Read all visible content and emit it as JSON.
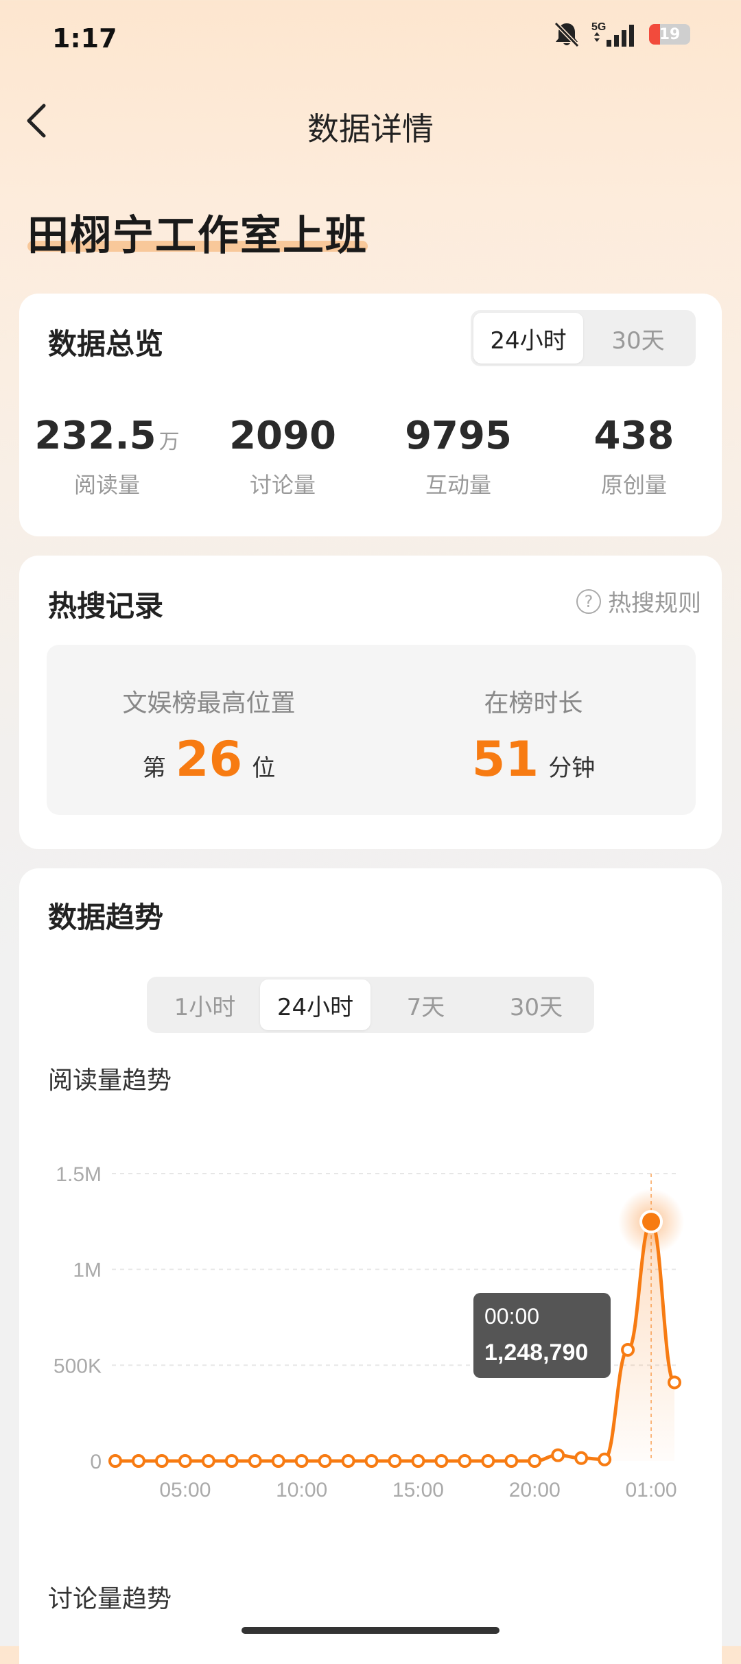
{
  "status_bar": {
    "time": "1:17",
    "battery": "19",
    "network": "5G"
  },
  "header": {
    "title": "数据详情"
  },
  "topic": {
    "title": "田栩宁工作室上班"
  },
  "overview": {
    "title": "数据总览",
    "range_tabs": [
      {
        "label": "24小时",
        "active": true
      },
      {
        "label": "30天",
        "active": false
      }
    ],
    "stats": [
      {
        "value": "232.5",
        "unit": "万",
        "label": "阅读量"
      },
      {
        "value": "2090",
        "unit": "",
        "label": "讨论量"
      },
      {
        "value": "9795",
        "unit": "",
        "label": "互动量"
      },
      {
        "value": "438",
        "unit": "",
        "label": "原创量"
      }
    ]
  },
  "hot_search": {
    "title": "热搜记录",
    "rules_label": "热搜规则",
    "highest": {
      "label": "文娱榜最高位置",
      "prefix": "第",
      "value": "26",
      "suffix": "位"
    },
    "duration": {
      "label": "在榜时长",
      "value": "51",
      "suffix": "分钟"
    }
  },
  "trend": {
    "title": "数据趋势",
    "tabs": [
      {
        "label": "1小时",
        "active": false
      },
      {
        "label": "24小时",
        "active": true
      },
      {
        "label": "7天",
        "active": false
      },
      {
        "label": "30天",
        "active": false
      }
    ],
    "read_trend_title": "阅读量趋势",
    "discussion_trend_title": "讨论量趋势",
    "tooltip": {
      "time": "00:00",
      "value": "1,248,790"
    }
  },
  "colors": {
    "accent": "#f77b12",
    "tooltip_bg": "#555555"
  },
  "chart_data": {
    "type": "line",
    "title": "阅读量趋势",
    "ylim": [
      0,
      1500000
    ],
    "y_ticks": [
      {
        "value": 0,
        "label": "0"
      },
      {
        "value": 500000,
        "label": "500K"
      },
      {
        "value": 1000000,
        "label": "1M"
      },
      {
        "value": 1500000,
        "label": "1.5M"
      }
    ],
    "x_ticks": [
      {
        "index": 3,
        "label": "05:00"
      },
      {
        "index": 8,
        "label": "10:00"
      },
      {
        "index": 13,
        "label": "15:00"
      },
      {
        "index": 18,
        "label": "20:00"
      },
      {
        "index": 23,
        "label": "01:00"
      }
    ],
    "series": [
      {
        "values": [
          0,
          0,
          0,
          0,
          0,
          0,
          0,
          0,
          0,
          0,
          0,
          0,
          0,
          0,
          0,
          0,
          0,
          0,
          0,
          30000,
          15000,
          8000,
          580000,
          1248790,
          410000
        ]
      }
    ],
    "highlight_index": 22
  }
}
